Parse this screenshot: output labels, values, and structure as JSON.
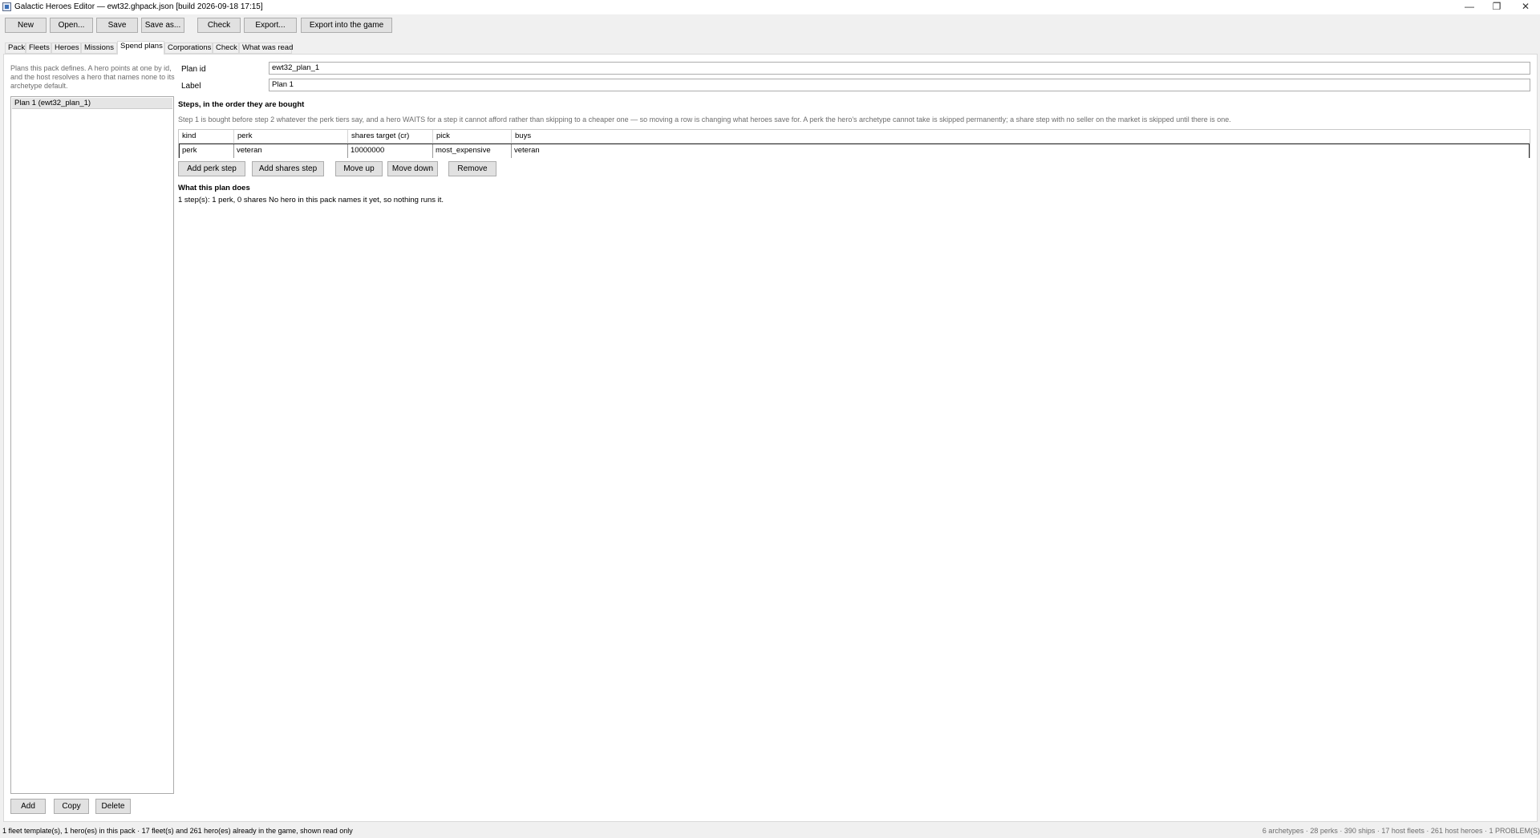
{
  "window": {
    "title": "Galactic Heroes Editor — ewt32.ghpack.json   [build 2026-09-18 17:15]",
    "minimize_glyph": "—",
    "maximize_glyph": "❐",
    "close_glyph": "✕"
  },
  "toolbar": {
    "new": "New",
    "open": "Open...",
    "save": "Save",
    "save_as": "Save as...",
    "check": "Check",
    "export": "Export...",
    "export_game": "Export into the game"
  },
  "tabs": [
    "Pack",
    "Fleets",
    "Heroes",
    "Missions",
    "Spend plans",
    "Corporations",
    "Check",
    "What was read"
  ],
  "active_tab": "Spend plans",
  "left": {
    "help": "Plans this pack defines. A hero points at one by id, and the host resolves a hero that names none to its archetype default.",
    "help_lines": [
      "Plans this pack defines. A hero points at one by id,",
      "and the host resolves a hero that names none to its",
      "archetype default."
    ],
    "plans": [
      "Plan 1  (ewt32_plan_1)"
    ],
    "add": "Add",
    "copy": "Copy",
    "delete": "Delete"
  },
  "form": {
    "plan_id_label": "Plan id",
    "plan_id_value": "ewt32_plan_1",
    "label_label": "Label",
    "label_value": "Plan 1"
  },
  "steps": {
    "heading": "Steps, in the order they are bought",
    "help": "Step 1 is bought before step 2 whatever the perk tiers say, and a hero WAITS for a step it cannot afford rather than skipping to a cheaper one — so moving a row is changing what heroes save for. A perk the hero's archetype cannot take is skipped permanently; a share step with no seller on the market is skipped until there is one.",
    "columns": [
      "kind",
      "perk",
      "shares target (cr)",
      "pick",
      "buys"
    ],
    "rows": [
      [
        "perk",
        "veteran",
        "10000000",
        "most_expensive",
        "veteran"
      ]
    ],
    "add_perk": "Add perk step",
    "add_shares": "Add shares step",
    "move_up": "Move up",
    "move_down": "Move down",
    "remove": "Remove"
  },
  "summary": {
    "heading": "What this plan does",
    "text": "1 step(s): 1 perk, 0 shares  No hero in this pack names it yet, so nothing runs it."
  },
  "status": {
    "left": "1 fleet template(s), 1 hero(es) in this pack · 17 fleet(s) and 261 hero(es) already in the game, shown read only",
    "right": "6 archetypes · 28 perks · 390 ships · 17 host fleets · 261 host heroes  ·  1 PROBLEM(S)"
  }
}
